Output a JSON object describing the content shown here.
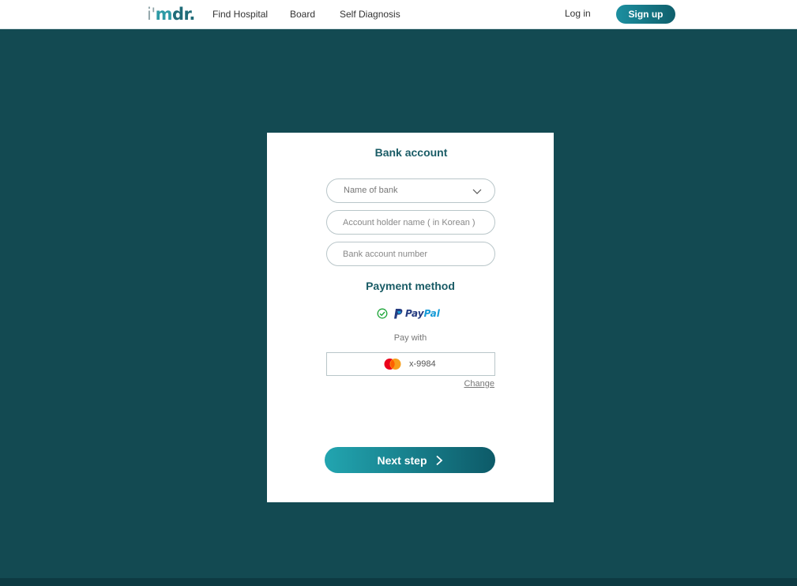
{
  "nav": {
    "logo": {
      "part1": "i'",
      "part2": "m",
      "part3": "dr."
    },
    "links": {
      "find_hospital": "Find Hospital",
      "board": "Board",
      "self_diagnosis": "Self Diagnosis"
    },
    "login": "Log in",
    "signup": "Sign up"
  },
  "card": {
    "bank_title": "Bank account",
    "bank_select": {
      "label": "Name of bank"
    },
    "holder_field": {
      "placeholder": "Account holder name ( in Korean )",
      "value": ""
    },
    "number_field": {
      "placeholder": "Bank account number",
      "value": ""
    },
    "payment_title": "Payment method",
    "payment_option": {
      "brand_part1": "Pay",
      "brand_part2": "Pal",
      "selected": true
    },
    "pay_with": "Pay with",
    "card_number": "x-9984",
    "change": "Change",
    "next": "Next step"
  },
  "colors": {
    "brand_primary": "#1f6b78",
    "background": "#134a52",
    "accent": "#22a5b0",
    "check": "#1fa63a"
  },
  "icons": {
    "select_chevron": "chevron-down-icon",
    "payment_check": "check-circle-icon",
    "card_brand": "mastercard-icon",
    "next_arrow": "chevron-right-icon"
  }
}
